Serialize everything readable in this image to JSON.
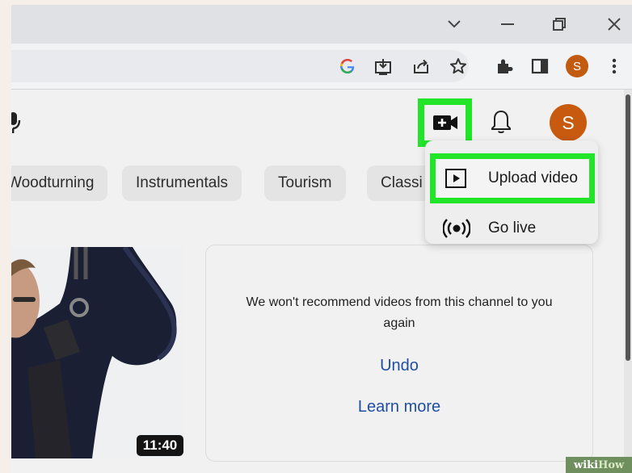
{
  "browser": {
    "profile_initial": "S",
    "window_buttons": [
      "chevron-down-icon",
      "minimize-icon",
      "restore-icon",
      "close-icon"
    ],
    "toolbar_icons": [
      "google-icon",
      "install-icon",
      "share-icon",
      "bookmark-star-icon",
      "extensions-icon",
      "side-panel-icon",
      "profile-avatar",
      "kebab-menu-icon"
    ]
  },
  "header": {
    "avatar_initial": "S",
    "create_button_highlight": "#22e52a",
    "avatar_color": "#c75a0f"
  },
  "chips": [
    {
      "label": "Woodturning"
    },
    {
      "label": "Instrumentals"
    },
    {
      "label": "Tourism"
    },
    {
      "label": "Classi"
    }
  ],
  "create_menu": {
    "items": [
      {
        "label": "Upload video",
        "icon": "upload-video-icon"
      },
      {
        "label": "Go live",
        "icon": "go-live-icon"
      }
    ]
  },
  "video": {
    "duration": "11:40"
  },
  "dismissed_card": {
    "message": "We won't recommend videos from this channel to you again",
    "undo_label": "Undo",
    "learn_more_label": "Learn more",
    "link_color": "#1f4fa2"
  },
  "watermark": {
    "prefix": "wiki",
    "suffix": "How"
  }
}
